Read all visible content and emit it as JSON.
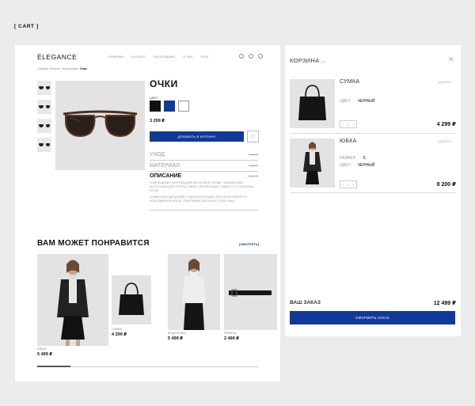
{
  "cart_tag": "[ CART ]",
  "header": {
    "logo": "ÉLEGANCE",
    "nav": [
      "НОВИНКИ",
      "КАТАЛОГ",
      "РАСПРОДАЖА",
      "О НАС",
      "БЛОГ"
    ]
  },
  "breadcrumb": {
    "path": "Главная / Каталог / Аксессуары / ",
    "current": "Очки"
  },
  "product": {
    "title": "ОЧКИ",
    "color_label": "ЦВЕТ:",
    "swatches": [
      "#111111",
      "#12399a",
      "#ffffff"
    ],
    "price": "3 299 ₽",
    "add_to_cart": "ДОБАВИТЬ В КОРЗИНУ",
    "fav_icon": "heart-icon",
    "accordion": [
      "УХОД",
      "МАТЕРИАЛ"
    ],
    "description_title": "ОПИСАНИЕ",
    "description_p1": "ОЧКИ ПОДОЙДУТ ДЛЯ ЕЖЕДНЕВНОЙ НОСКИ В ГОРОДЕ, НЕЗАМЕНИМЫЕ АКСЕССУАРЫ ДЛЯ ОТПУСКА. ЛИНЗЫ ОБЕСПЕЧИВАЮТ ЗАЩИТУ ОТ СОЛНЕЧНЫХ ЛУЧЕЙ",
    "description_p2": "УНИВЕРСАЛЬНЫЙ ДИЗАЙН И УДОБНАЯ ПОСАДКА ОБЕСПЕЧАТ КОМФОРТ В ПОВСЕДНЕВНОЙ НОСКЕ. ПРАКТИЧНЫЕ ДЛЯ ЛЮБОГО ТИПА ЛИЦА"
  },
  "recommendations": {
    "title": "ВАМ МОЖЕТ ПОНРАВИТСЯ",
    "see_all": "[СМОТРЕТЬ]",
    "progress": 0.15,
    "items": [
      {
        "label": "ЮБКА",
        "price": "5 499 ₽"
      },
      {
        "label": "СУМКА",
        "price": "4 299 ₽"
      },
      {
        "label": "ВОДОЛАЗКА",
        "price": "5 499 ₽"
      },
      {
        "label": "РЕМЕНЬ",
        "price": "2 499 ₽"
      }
    ]
  },
  "cart": {
    "title": "КОРЗИНА",
    "count": "(2)",
    "close_icon": "close-icon",
    "remove_label": "УДАЛИТЬ",
    "items": [
      {
        "name": "СУМКА",
        "props": [
          {
            "k": "ЦВЕТ:",
            "v": "ЧЕРНЫЙ"
          }
        ],
        "qty": "1",
        "price": "4 299 ₽"
      },
      {
        "name": "ЮБКА",
        "props": [
          {
            "k": "РАЗМЕР:",
            "v": "S"
          },
          {
            "k": "ЦВЕТ:",
            "v": "ЧЕРНЫЙ"
          }
        ],
        "qty": "1",
        "price": "8 200 ₽"
      }
    ],
    "order_label": "ВАШ ЗАКАЗ",
    "order_total": "12 499 ₽",
    "checkout": "ОФОРМИТЬ ЗАКАЗ"
  }
}
